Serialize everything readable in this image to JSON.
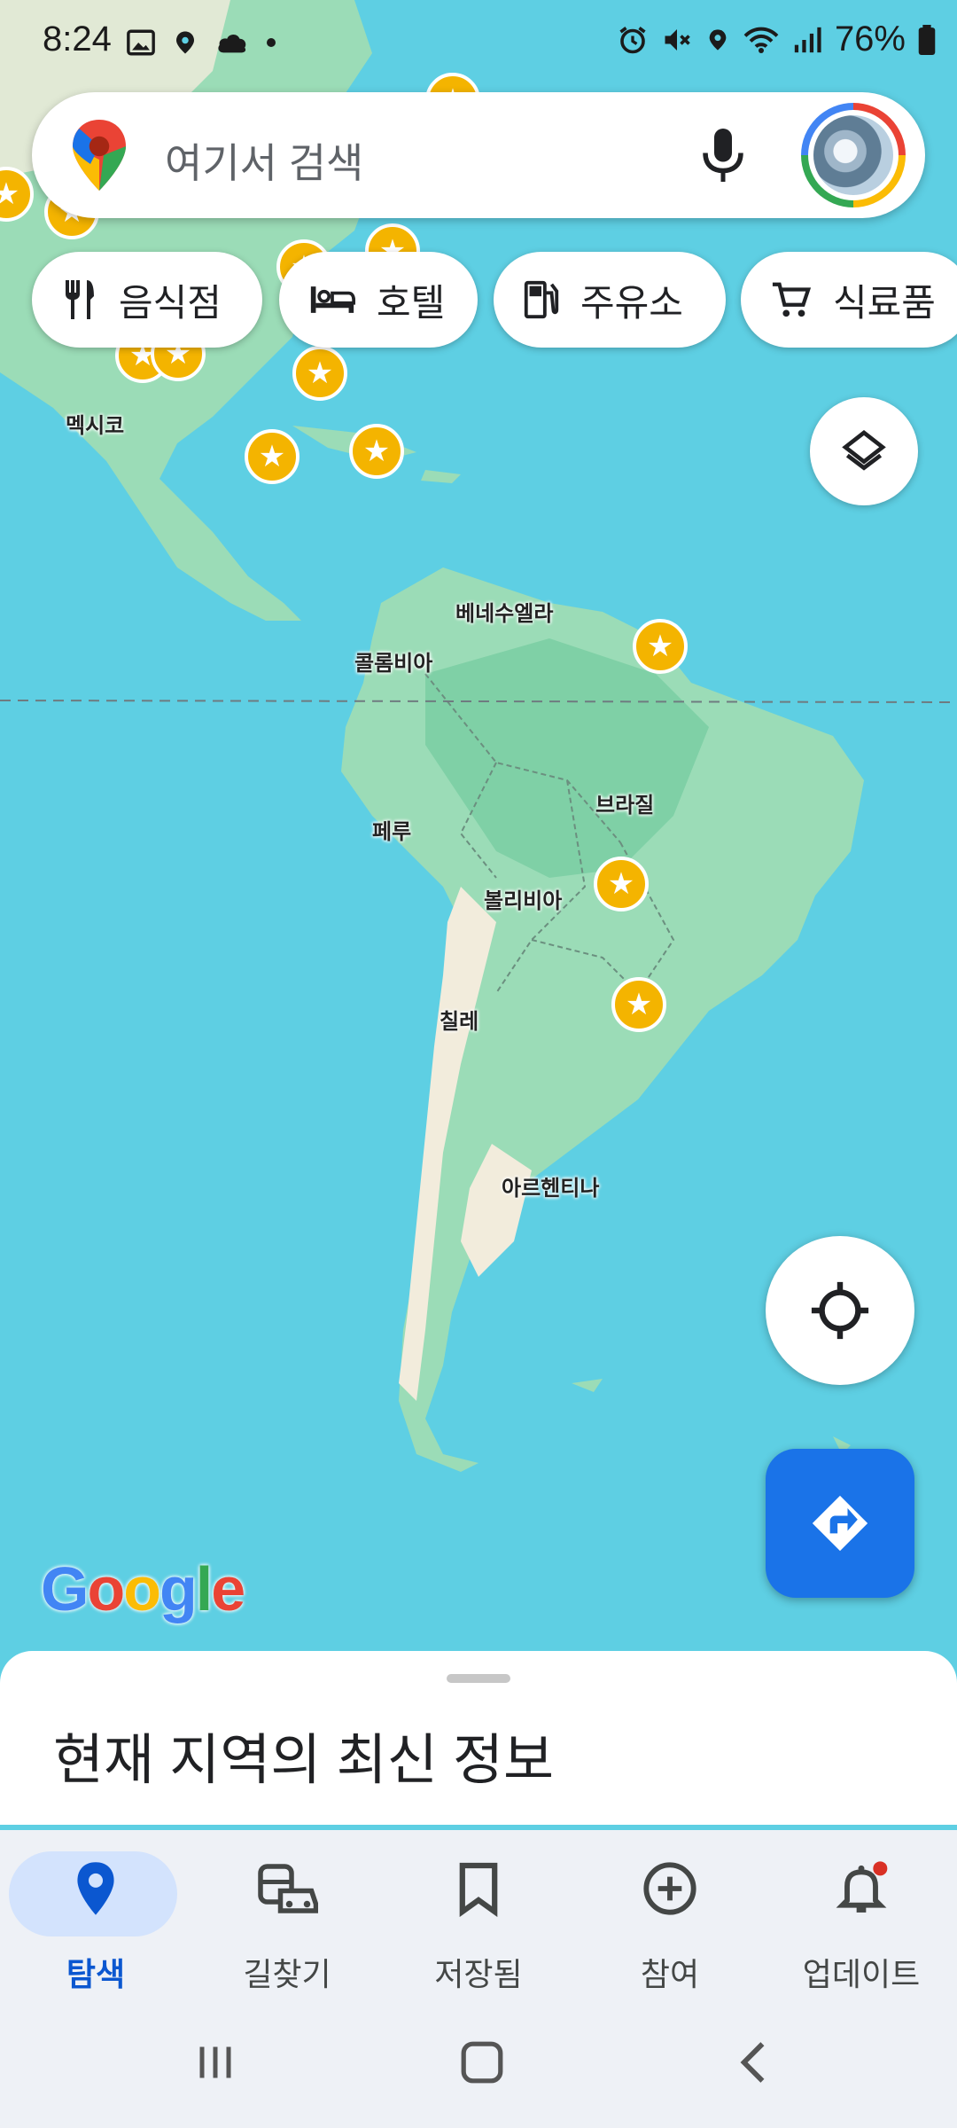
{
  "status_bar": {
    "time": "8:24",
    "battery": "76%",
    "left_icons": [
      "gallery-icon",
      "location-icon",
      "cloud-sync-icon",
      "dot-icon"
    ],
    "right_icons": [
      "alarm-icon",
      "mute-icon",
      "location-icon",
      "wifi-icon",
      "signal-icon",
      "battery-icon"
    ]
  },
  "search": {
    "placeholder": "여기서 검색",
    "mic_icon": "microphone-icon",
    "avatar": "account-avatar"
  },
  "chips": [
    {
      "label": "음식점",
      "icon": "restaurant-icon"
    },
    {
      "label": "호텔",
      "icon": "hotel-icon"
    },
    {
      "label": "주유소",
      "icon": "gas-station-icon"
    },
    {
      "label": "식료품",
      "icon": "grocery-cart-icon"
    }
  ],
  "map": {
    "labels": [
      "멕시코",
      "베네수엘라",
      "콜롬비아",
      "브라질",
      "페루",
      "볼리비아",
      "칠레",
      "아르헨티나"
    ],
    "logo": "Google",
    "colors": {
      "water": "#5ecfe3",
      "land": "#9bdcb7",
      "land_dark": "#7fd0a6",
      "desert": "#f2ecdc"
    }
  },
  "buttons": {
    "layers_icon": "layers-icon",
    "locate_icon": "my-location-icon",
    "directions_icon": "directions-icon"
  },
  "sheet": {
    "title": "현재 지역의 최신 정보"
  },
  "nav": {
    "items": [
      {
        "label": "탐색",
        "icon": "explore-pin-icon",
        "active": true
      },
      {
        "label": "길찾기",
        "icon": "commute-icon"
      },
      {
        "label": "저장됨",
        "icon": "bookmark-icon"
      },
      {
        "label": "참여",
        "icon": "add-circle-icon"
      },
      {
        "label": "업데이트",
        "icon": "bell-icon",
        "badge": true
      }
    ]
  },
  "system_nav": [
    "recents-icon",
    "home-icon",
    "back-icon"
  ]
}
